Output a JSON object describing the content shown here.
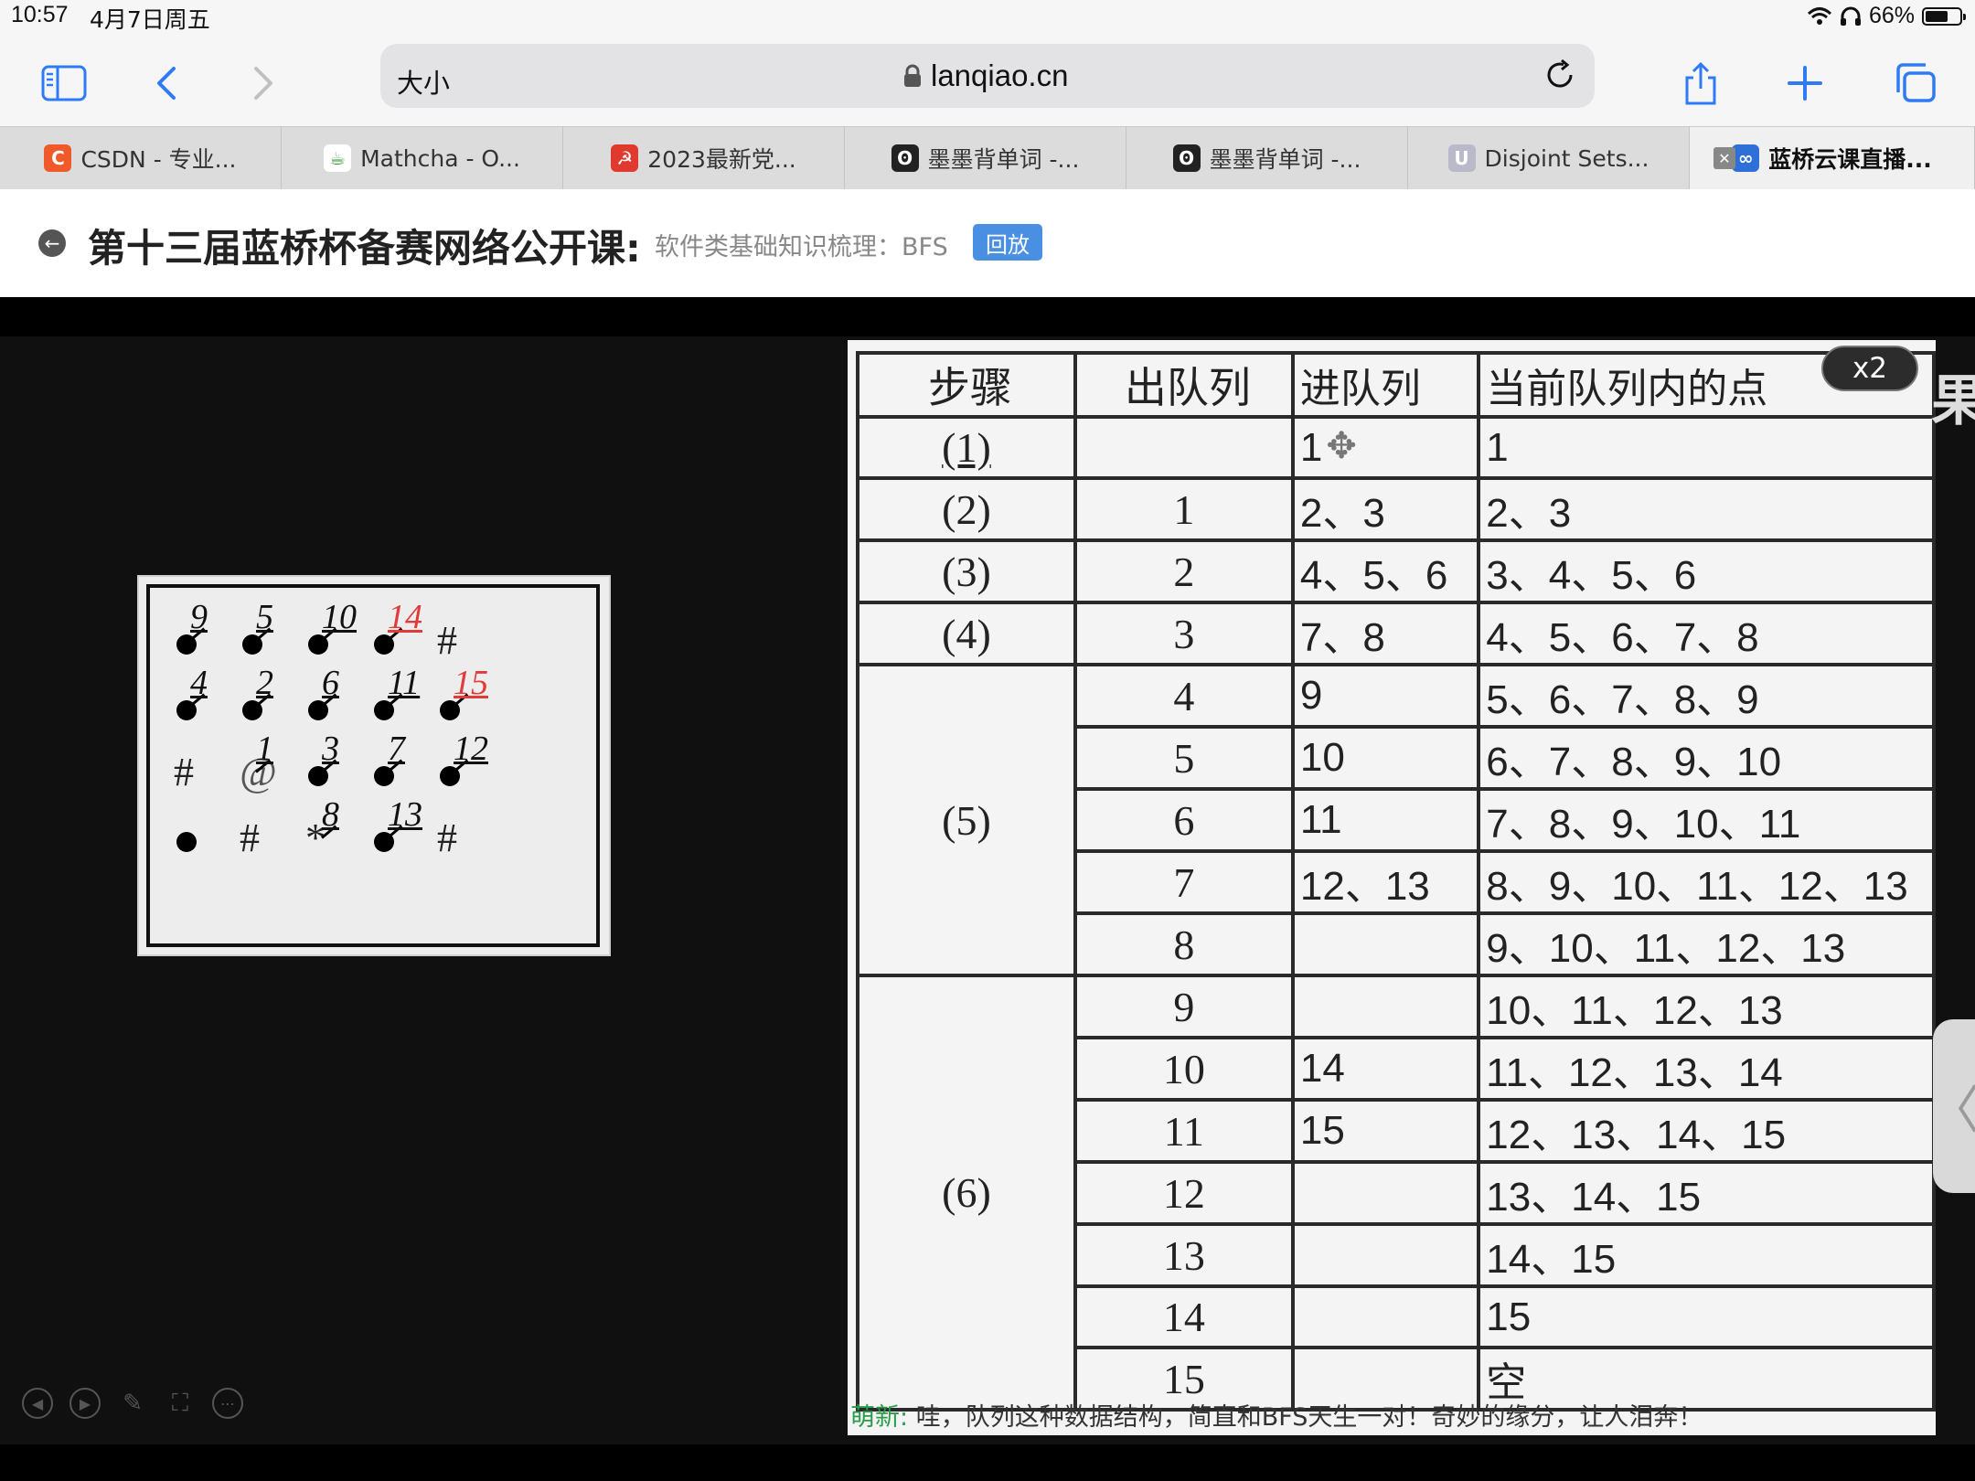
{
  "status": {
    "time": "10:57",
    "date": "4月7日周五",
    "battery": "66%",
    "battery_level": 0.66
  },
  "toolbar": {
    "size_label": "大小",
    "url": "lanqiao.cn"
  },
  "tabs": [
    {
      "label": "CSDN - 专业...",
      "icon": "csdn-icon",
      "icon_text": "C",
      "color": "#f05a2a"
    },
    {
      "label": "Mathcha - O...",
      "icon": "mathcha-icon",
      "icon_text": "☕",
      "color": "#ffffff"
    },
    {
      "label": "2023最新党...",
      "icon": "party-icon",
      "icon_text": "☭",
      "color": "#e03a2f"
    },
    {
      "label": "墨墨背单词 -...",
      "icon": "maimemo-icon",
      "icon_text": "ʘ",
      "color": "#222222"
    },
    {
      "label": "墨墨背单词 -...",
      "icon": "maimemo-icon",
      "icon_text": "ʘ",
      "color": "#222222"
    },
    {
      "label": "Disjoint Sets...",
      "icon": "udemy-icon",
      "icon_text": "U",
      "color": "#b9b9c9"
    },
    {
      "label": "蓝桥云课直播...",
      "icon": "lanqiao-icon",
      "icon_text": "∞",
      "color": "#2e6fd8",
      "active": true
    }
  ],
  "page": {
    "title": "第十三届蓝桥杯备赛网络公开课:",
    "subtitle": "软件类基础知识梳理：BFS",
    "badge": "回放"
  },
  "grid": {
    "labels": [
      "9",
      "5",
      "10",
      "14",
      "4",
      "2",
      "6",
      "11",
      "15",
      "1",
      "3",
      "7",
      "12",
      "8",
      "13"
    ],
    "red_labels": [
      "14",
      "15"
    ],
    "symbols": {
      "hash": "#",
      "at": "@",
      "star": "*"
    }
  },
  "table": {
    "headers": [
      "步骤",
      "出队列",
      "进队列",
      "当前队列内的点"
    ],
    "rows": [
      {
        "step": "(1)",
        "dequeue": "",
        "enqueue": "1",
        "current": "1"
      },
      {
        "step": "(2)",
        "dequeue": "1",
        "enqueue": "2、3",
        "current": "2、3"
      },
      {
        "step": "(3)",
        "dequeue": "2",
        "enqueue": "4、5、6",
        "current": "3、4、5、6"
      },
      {
        "step": "(4)",
        "dequeue": "3",
        "enqueue": "7、8",
        "current": "4、5、6、7、8"
      },
      {
        "step": "(5)",
        "dequeue": "4",
        "enqueue": "9",
        "current": "5、6、7、8、9"
      },
      {
        "step": "",
        "dequeue": "5",
        "enqueue": "10",
        "current": "6、7、8、9、10"
      },
      {
        "step": "",
        "dequeue": "6",
        "enqueue": "11",
        "current": "7、8、9、10、11"
      },
      {
        "step": "",
        "dequeue": "7",
        "enqueue": "12、13",
        "current": "8、9、10、11、12、13"
      },
      {
        "step": "",
        "dequeue": "8",
        "enqueue": "",
        "current": "9、10、11、12、13"
      },
      {
        "step": "(6)",
        "dequeue": "9",
        "enqueue": "",
        "current": "10、11、12、13"
      },
      {
        "step": "",
        "dequeue": "10",
        "enqueue": "14",
        "current": "11、12、13、14"
      },
      {
        "step": "",
        "dequeue": "11",
        "enqueue": "15",
        "current": "12、13、14、15"
      },
      {
        "step": "",
        "dequeue": "12",
        "enqueue": "",
        "current": "13、14、15"
      },
      {
        "step": "",
        "dequeue": "13",
        "enqueue": "",
        "current": "14、15"
      },
      {
        "step": "",
        "dequeue": "14",
        "enqueue": "",
        "current": "15"
      },
      {
        "step": "",
        "dequeue": "15",
        "enqueue": "",
        "current": "空"
      }
    ]
  },
  "player": {
    "speed": "x2",
    "edge_char": "果",
    "handle": "〈"
  },
  "danmaku": {
    "name": "萌新:",
    "text": " 哇，队列这种数据结构，简直和BFS天生一对！奇妙的缘分，让人泪奔！"
  }
}
